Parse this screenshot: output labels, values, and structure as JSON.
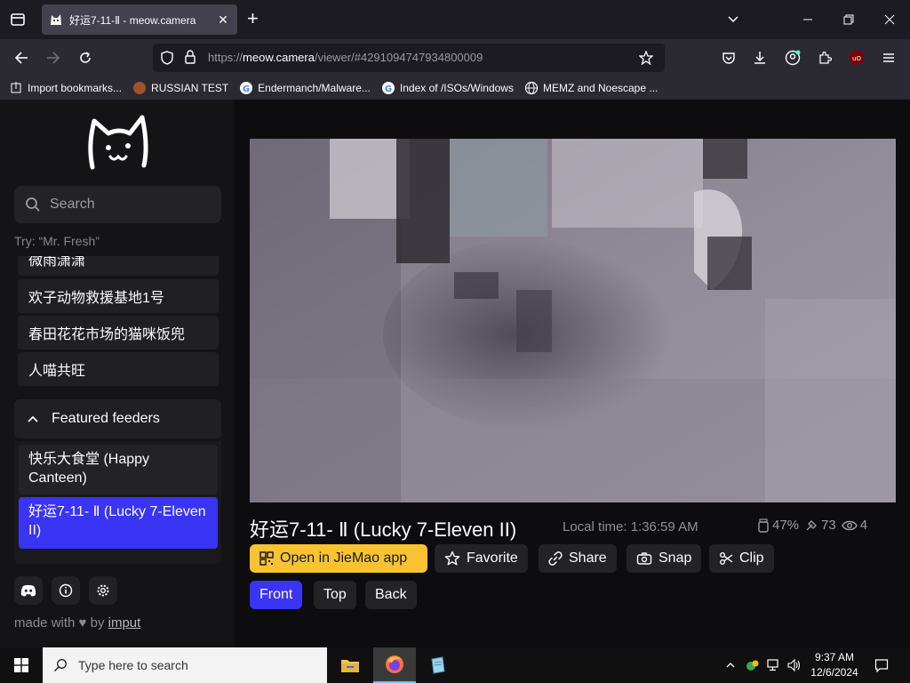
{
  "browser": {
    "tab_title": "好运7-11-Ⅱ - meow.camera",
    "url_prefix": "https://",
    "url_domain": "meow.camera",
    "url_path": "/viewer/#4291094747934800009",
    "bookmarks": [
      {
        "label": "Import bookmarks...",
        "icon": "import-icon"
      },
      {
        "label": "RUSSIAN TEST",
        "icon": "site-icon"
      },
      {
        "label": "Endermanch/Malware...",
        "icon": "google-icon"
      },
      {
        "label": "Index of /ISOs/Windows",
        "icon": "google-icon"
      },
      {
        "label": "MEMZ and Noescape ...",
        "icon": "globe-icon"
      }
    ]
  },
  "sidebar": {
    "search_label": "Search",
    "hint": "Try: “Mr. Fresh”",
    "feeders": [
      {
        "label": "微雨潇潇"
      },
      {
        "label": "欢子动物救援基地1号"
      },
      {
        "label": "春田花花市场的猫咪饭兜"
      },
      {
        "label": "人喵共旺"
      }
    ],
    "featured_header": "Featured feeders",
    "featured": [
      {
        "label": "快乐大食堂 (Happy Canteen)",
        "selected": false
      },
      {
        "label": "好运7-11- Ⅱ (Lucky 7-Eleven II)",
        "selected": true
      }
    ],
    "made_with_prefix": "made with",
    "made_with_by": "by",
    "made_with_link": "imput"
  },
  "viewer": {
    "title": "好运7-11- Ⅱ (Lucky 7-Eleven II)",
    "local_time": "Local time: 1:36:59 AM",
    "food_level": "47%",
    "feed_count": "73",
    "viewers": "4",
    "actions": {
      "open_app": "Open in JieMao app",
      "favorite": "Favorite",
      "share": "Share",
      "snap": "Snap",
      "clip": "Clip"
    },
    "cameras": [
      "Front",
      "Top",
      "Back"
    ],
    "selected_camera": "Front"
  },
  "taskbar": {
    "search_placeholder": "Type here to search",
    "time": "9:37 AM",
    "date": "12/6/2024"
  },
  "colors": {
    "accent_blue": "#3a34f5",
    "app_yellow": "#f7c331",
    "sidebar_bg": "#141416"
  }
}
